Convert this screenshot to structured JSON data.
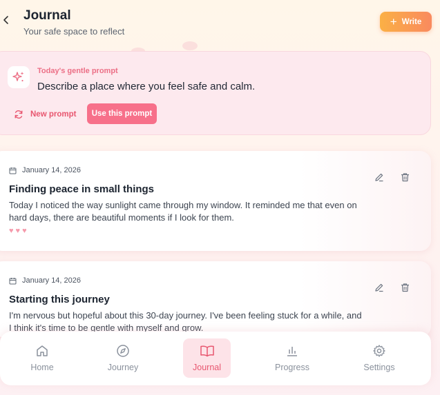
{
  "header": {
    "back_icon": "chevron-left-icon",
    "title": "Journal",
    "subtitle": "Your safe space to reflect",
    "write_label": "Write"
  },
  "prompt": {
    "icon": "sparkle-icon",
    "label": "Today's gentle prompt",
    "text": "Describe a place where you feel safe and calm.",
    "new_prompt_label": "New prompt",
    "use_prompt_label": "Use this prompt"
  },
  "entries": [
    {
      "date": "January 14, 2026",
      "title": "Finding peace in small things",
      "body": "Today I noticed the way sunlight came through my window. It reminded me that even on hard days, there are beautiful moments if I look for them.",
      "hearts": 3
    },
    {
      "date": "January 14, 2026",
      "title": "Starting this journey",
      "body": "I'm nervous but hopeful about this 30-day journey. I've been feeling stuck for a while, and I think it's time to be gentle with myself and grow."
    }
  ],
  "nav": {
    "items": [
      {
        "label": "Home",
        "icon": "home-icon"
      },
      {
        "label": "Journey",
        "icon": "compass-icon"
      },
      {
        "label": "Journal",
        "icon": "book-icon",
        "active": true
      },
      {
        "label": "Progress",
        "icon": "bar-chart-icon"
      },
      {
        "label": "Settings",
        "icon": "gear-icon"
      }
    ]
  },
  "colors": {
    "accent": "#f7708a",
    "write_gradient_start": "#fbb045",
    "write_gradient_end": "#f98a5f",
    "prompt_bg": "#fde9ee"
  }
}
